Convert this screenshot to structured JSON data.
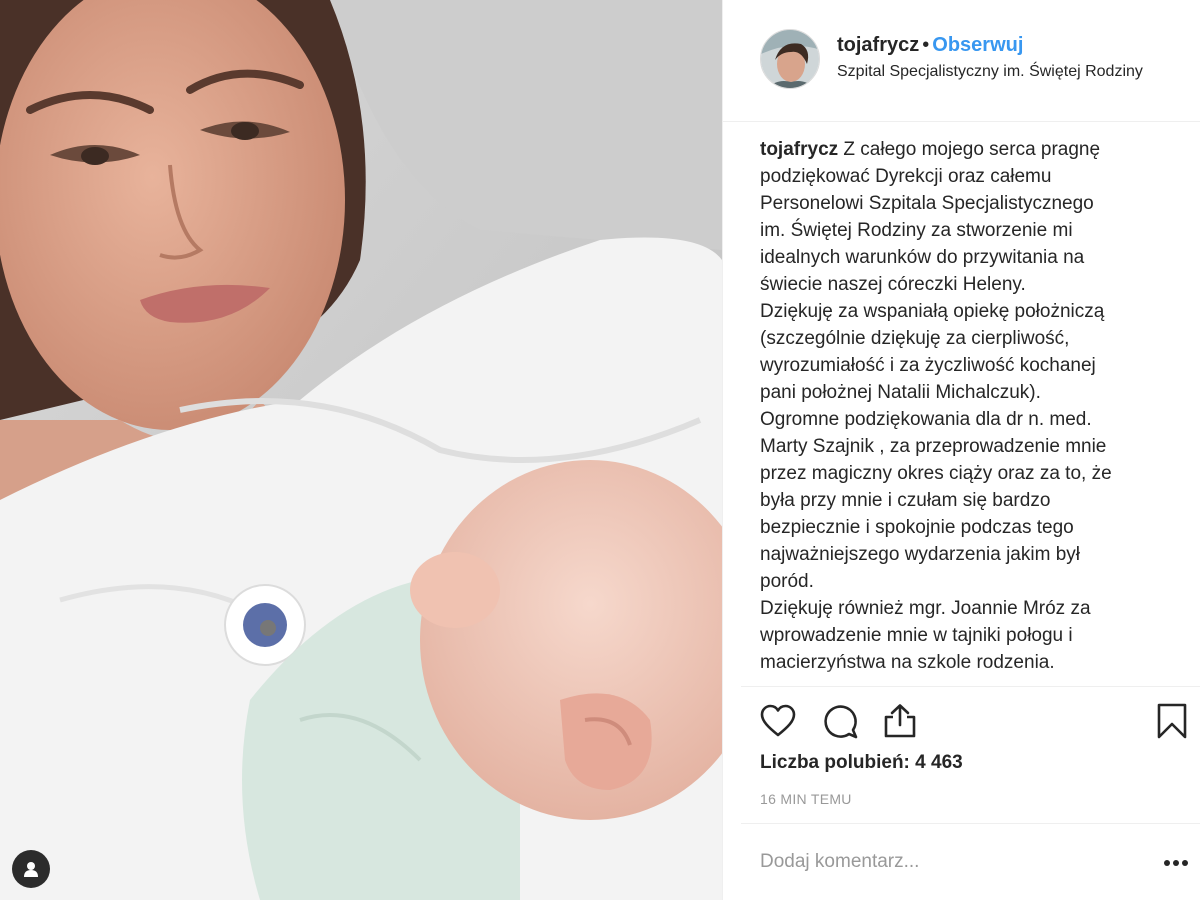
{
  "header": {
    "username": "tojafrycz",
    "separator": "•",
    "follow_label": "Obserwuj",
    "location": "Szpital Specjalistyczny im. Świętej Rodziny"
  },
  "caption": {
    "username": "tojafrycz",
    "lines": [
      "Z całego mojego serca pragnę",
      "podziękować Dyrekcji oraz całemu",
      "Personelowi Szpitala Specjalistycznego",
      "im. Świętej Rodziny za stworzenie mi",
      "idealnych warunków do przywitania na",
      "świecie naszej córeczki Heleny.",
      "Dziękuję za wspaniałą opiekę położniczą",
      "(szczególnie dziękuję za cierpliwość,",
      "wyrozumiałość i za życzliwość kochanej",
      "pani położnej Natalii Michalczuk).",
      "Ogromne podziękowania dla dr n. med.",
      "Marty Szajnik , za przeprowadzenie mnie",
      "przez magiczny okres ciąży oraz za to, że",
      "była przy mnie i czułam się bardzo",
      "bezpiecznie i spokojnie podczas tego",
      "najważniejszego wydarzenia jakim był",
      "poród.",
      "Dziękuję również mgr. Joannie Mróz za",
      "wprowadzenie mnie w tajniki połogu i",
      "macierzyństwa na szkole rodzenia."
    ]
  },
  "actions": {
    "icons": [
      "heart-icon",
      "comment-icon",
      "share-icon",
      "bookmark-icon"
    ]
  },
  "likes": "Liczba polubień: 4 463",
  "timestamp": "16 MIN TEMU",
  "comment": {
    "placeholder": "Dodaj komentarz...",
    "more_label": "•••"
  },
  "colors": {
    "follow": "#3897f0",
    "text": "#262626",
    "muted": "#999999",
    "border": "#efefef"
  }
}
